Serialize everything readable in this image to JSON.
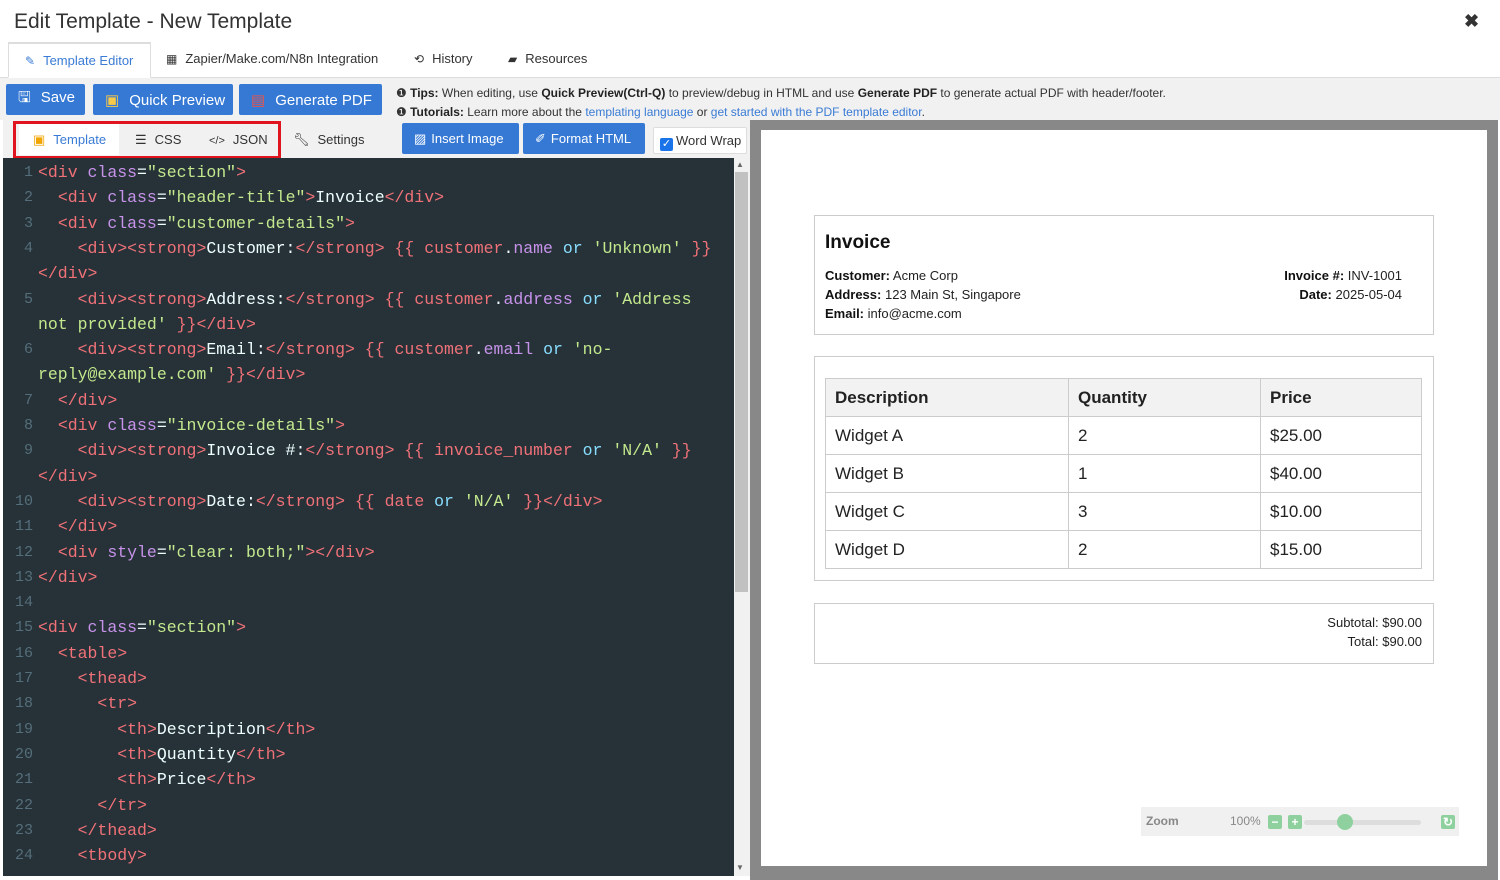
{
  "window": {
    "title": "Edit Template - New Template",
    "close_icon": "close-icon"
  },
  "tabs": [
    {
      "label": "Template Editor",
      "icon": "pencil-icon",
      "active": true
    },
    {
      "label": "Zapier/Make.com/N8n Integration",
      "icon": "table-icon"
    },
    {
      "label": "History",
      "icon": "history-icon"
    },
    {
      "label": "Resources",
      "icon": "book-icon"
    }
  ],
  "toolbar": {
    "save_label": "Save",
    "quick_preview_label": "Quick Preview",
    "generate_pdf_label": "Generate PDF",
    "accent_color": "#3579d4"
  },
  "tips": {
    "tips_label": "Tips:",
    "tips_t1": "When editing, use",
    "tips_b1": "Quick Preview(Ctrl-Q)",
    "tips_t2": "to preview/debug in HTML and use",
    "tips_b2": "Generate PDF",
    "tips_t3": "to generate actual PDF with header/footer.",
    "tutorials_label": "Tutorials:",
    "tut_t1": "Learn more about the",
    "tut_link1": "templating language",
    "tut_t2": "or",
    "tut_link2": "get started with the PDF template editor",
    "tut_t3": "."
  },
  "editor_tabs": {
    "template": "Template",
    "css": "CSS",
    "json": "JSON",
    "settings": "Settings",
    "insert_image": "Insert Image",
    "format_html": "Format HTML",
    "word_wrap": "Word Wrap",
    "word_wrap_checked": true
  },
  "code_lines": [
    {
      "n": "1",
      "t": "<div class=\"section\">"
    },
    {
      "n": "2",
      "t": "  <div class=\"header-title\">Invoice</div>"
    },
    {
      "n": "3",
      "t": "  <div class=\"customer-details\">"
    },
    {
      "n": "4",
      "t": "    <div><strong>Customer:</strong> {{ customer.name or 'Unknown' }}"
    },
    {
      "n": "",
      "t": "</div>"
    },
    {
      "n": "5",
      "t": "    <div><strong>Address:</strong> {{ customer.address or 'Address"
    },
    {
      "n": "",
      "t": "not provided' }}</div>"
    },
    {
      "n": "6",
      "t": "    <div><strong>Email:</strong> {{ customer.email or 'no-"
    },
    {
      "n": "",
      "t": "reply@example.com' }}</div>"
    },
    {
      "n": "7",
      "t": "  </div>"
    },
    {
      "n": "8",
      "t": "  <div class=\"invoice-details\">"
    },
    {
      "n": "9",
      "t": "    <div><strong>Invoice #:</strong> {{ invoice_number or 'N/A' }}"
    },
    {
      "n": "",
      "t": "</div>"
    },
    {
      "n": "10",
      "t": "    <div><strong>Date:</strong> {{ date or 'N/A' }}</div>"
    },
    {
      "n": "11",
      "t": "  </div>"
    },
    {
      "n": "12",
      "t": "  <div style=\"clear: both;\"></div>"
    },
    {
      "n": "13",
      "t": "</div>"
    },
    {
      "n": "14",
      "t": ""
    },
    {
      "n": "15",
      "t": "<div class=\"section\">"
    },
    {
      "n": "16",
      "t": "  <table>"
    },
    {
      "n": "17",
      "t": "    <thead>"
    },
    {
      "n": "18",
      "t": "      <tr>"
    },
    {
      "n": "19",
      "t": "        <th>Description</th>"
    },
    {
      "n": "20",
      "t": "        <th>Quantity</th>"
    },
    {
      "n": "21",
      "t": "        <th>Price</th>"
    },
    {
      "n": "22",
      "t": "      </tr>"
    },
    {
      "n": "23",
      "t": "    </thead>"
    },
    {
      "n": "24",
      "t": "    <tbody>"
    }
  ],
  "preview": {
    "title": "Invoice",
    "customer_label": "Customer:",
    "customer_value": "Acme Corp",
    "address_label": "Address:",
    "address_value": "123 Main St, Singapore",
    "email_label": "Email:",
    "email_value": "info@acme.com",
    "invoice_label": "Invoice #:",
    "invoice_value": "INV-1001",
    "date_label": "Date:",
    "date_value": "2025-05-04",
    "table": {
      "headers": [
        "Description",
        "Quantity",
        "Price"
      ],
      "rows": [
        [
          "Widget A",
          "2",
          "$25.00"
        ],
        [
          "Widget B",
          "1",
          "$40.00"
        ],
        [
          "Widget C",
          "3",
          "$10.00"
        ],
        [
          "Widget D",
          "2",
          "$15.00"
        ]
      ]
    },
    "subtotal": "Subtotal: $90.00",
    "total": "Total: $90.00"
  },
  "zoom": {
    "label": "Zoom",
    "value": "100%",
    "minus": "−",
    "plus": "+",
    "reset": "↻",
    "level": 0.33
  }
}
